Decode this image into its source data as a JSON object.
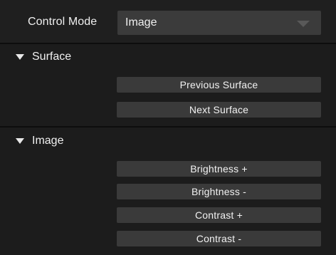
{
  "control_mode": {
    "label": "Control Mode",
    "value": "Image"
  },
  "sections": {
    "surface": {
      "title": "Surface",
      "buttons": [
        "Previous Surface",
        "Next Surface"
      ]
    },
    "image": {
      "title": "Image",
      "buttons": [
        "Brightness +",
        "Brightness -",
        "Contrast +",
        "Contrast -"
      ]
    }
  },
  "colors": {
    "background": "#1c1c1c",
    "button": "#3a3a3a",
    "select": "#3b3b3b",
    "text": "#f0f0f0"
  },
  "icons": {
    "dropdown": "chevron-down-icon",
    "disclosure": "disclosure-triangle-icon"
  }
}
